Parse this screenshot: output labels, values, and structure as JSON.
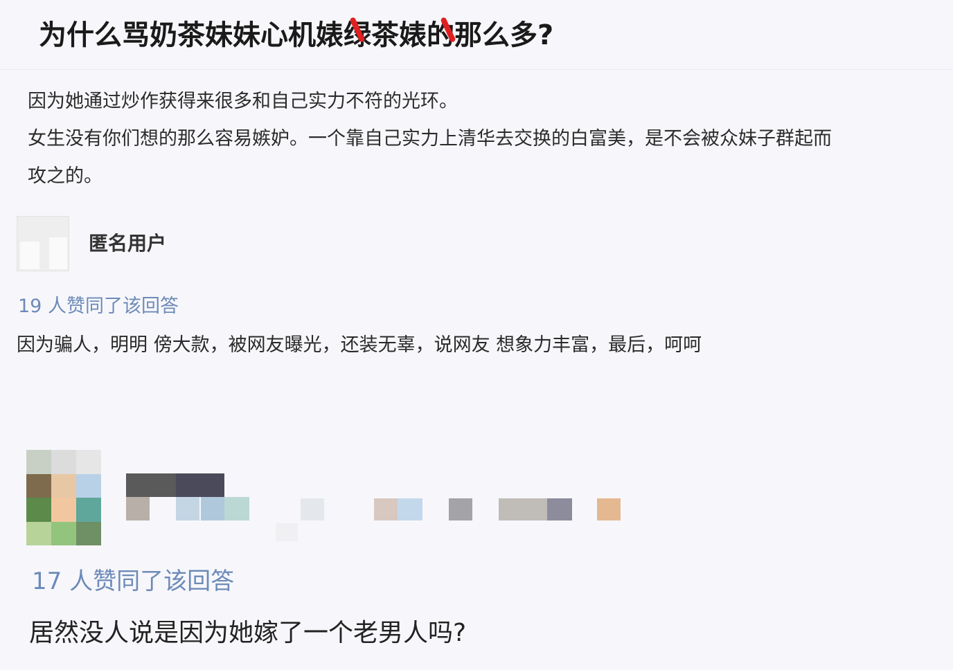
{
  "question": {
    "title": "为什么骂奶茶妹妹心机婊绿茶婊的那么多?"
  },
  "answer_top": {
    "line1": "因为她通过炒作获得来很多和自己实力不符的光环。",
    "line2": "女生没有你们想的那么容易嫉妒。一个靠自己实力上清华去交换的白富美，是不会被众妹子群起而",
    "line3": "攻之的。"
  },
  "answer_1": {
    "username": "匿名用户",
    "upvotes": "19 人赞同了该回答",
    "text": "因为骗人，明明 傍大款，被网友曝光，还装无辜，说网友 想象力丰富，最后，呵呵"
  },
  "answer_2": {
    "upvotes": "17 人赞同了该回答",
    "text": "居然没人说是因为她嫁了一个老男人吗?"
  },
  "colors": {
    "title_strike": "#e02020",
    "upvote_text": "#6d8ab8",
    "background": "#f7f7fb"
  },
  "mosaic": {
    "avatar_colors": [
      "#c8cfc4",
      "#dcdcdc",
      "#e6e6e6",
      "#7e6a4c",
      "#e8c7a4",
      "#b9d1e6",
      "#5b8a4a",
      "#f2c7a0",
      "#5fa79b",
      "#b7d39a",
      "#93c47d",
      "#6f8f64"
    ],
    "name_colors": [
      "#5a5a5a",
      "#4a4a5a",
      "#b8b0a8",
      "#c4d6e4",
      "#b0c8dc",
      "#bcd8d4",
      "#f0f0f2",
      "#e4e8ec",
      "#d8c8c0",
      "#c4d8ec",
      "#a4a4a8",
      "#c0bcb8",
      "#8c8c9c",
      "#e4b890"
    ]
  }
}
